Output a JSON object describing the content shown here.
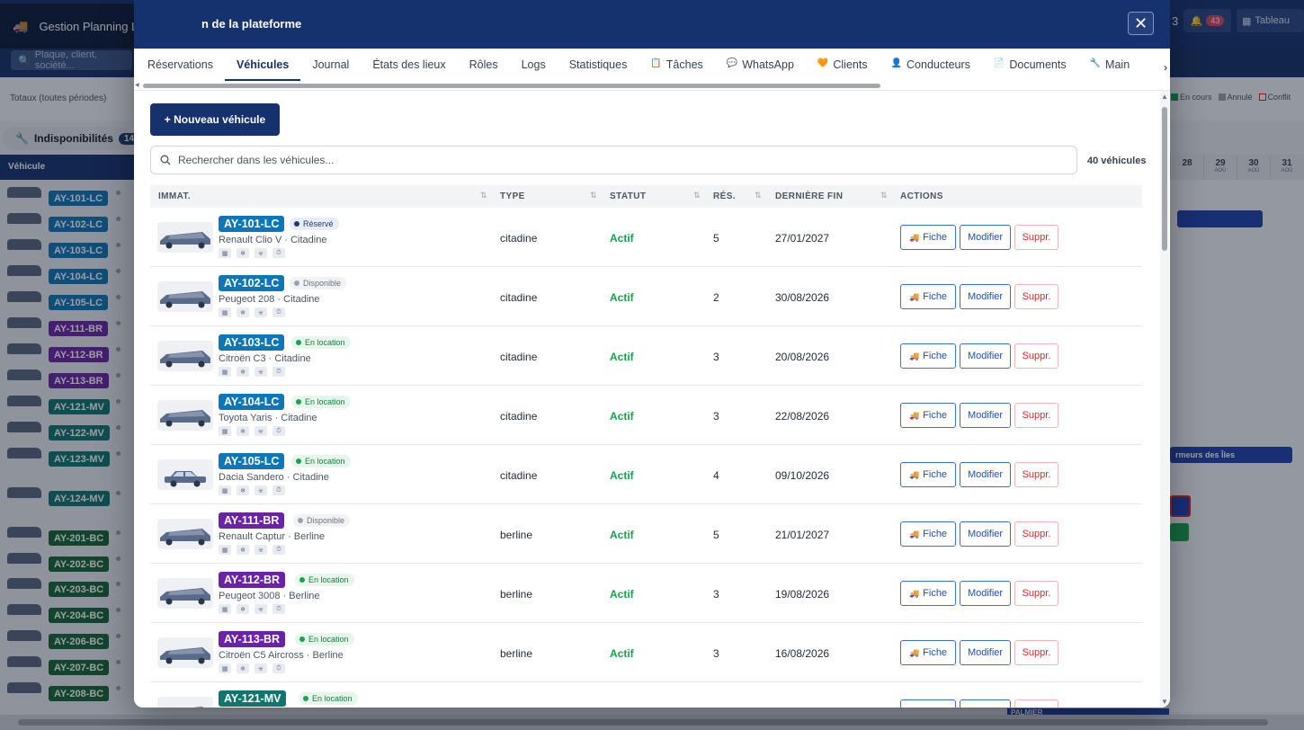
{
  "background": {
    "app_title": "Gestion Planning Lite",
    "search_placeholder": "Plaque, client, société...",
    "notif_count": "3",
    "bell_count": "43",
    "board_label": "Tableau",
    "totals_label": "Totaux (toutes périodes)",
    "legend": [
      {
        "label": "En cours",
        "color": "#16a34a"
      },
      {
        "label": "Annulé",
        "color": "#9ca3af"
      },
      {
        "label": "Conflit",
        "color": "#dc2626"
      }
    ],
    "indispo_label": "Indisponibilités",
    "indispo_count": "14",
    "column_header": "Véhicule",
    "rows": [
      {
        "plate": "AY-101-LC",
        "color": "#0b76b8"
      },
      {
        "plate": "AY-102-LC",
        "color": "#0b76b8"
      },
      {
        "plate": "AY-103-LC",
        "color": "#0b76b8"
      },
      {
        "plate": "AY-104-LC",
        "color": "#0b76b8"
      },
      {
        "plate": "AY-105-LC",
        "color": "#0b76b8"
      },
      {
        "plate": "AY-111-BR",
        "color": "#6b21a8"
      },
      {
        "plate": "AY-112-BR",
        "color": "#6b21a8"
      },
      {
        "plate": "AY-113-BR",
        "color": "#6b21a8"
      },
      {
        "plate": "AY-121-MV",
        "color": "#0f766e"
      },
      {
        "plate": "AY-122-MV",
        "color": "#0f766e"
      },
      {
        "plate": "AY-123-MV",
        "color": "#0f766e"
      },
      {
        "plate": "AY-124-MV",
        "color": "#0f766e"
      },
      {
        "plate": "AY-201-BC",
        "color": "#166534"
      },
      {
        "plate": "AY-202-BC",
        "color": "#166534"
      },
      {
        "plate": "AY-203-BC",
        "color": "#166534"
      },
      {
        "plate": "AY-204-BC",
        "color": "#166534"
      },
      {
        "plate": "AY-206-BC",
        "color": "#166534"
      },
      {
        "plate": "AY-207-BC",
        "color": "#166534"
      },
      {
        "plate": "AY-208-BC",
        "color": "#166534"
      }
    ],
    "days": [
      {
        "num": "28",
        "month": ""
      },
      {
        "num": "29",
        "month": "AOÛ"
      },
      {
        "num": "30",
        "month": "AOÛ"
      },
      {
        "num": "31",
        "month": "AOÛ"
      }
    ],
    "booking_label": "rmeurs des Îles",
    "palmier_label": "PALMIER"
  },
  "modal": {
    "title": "n de la plateforme",
    "close_label": "✕",
    "tabs": [
      {
        "label": "Réservations",
        "icon": "",
        "active": false
      },
      {
        "label": "Véhicules",
        "icon": "",
        "active": true
      },
      {
        "label": "Journal",
        "icon": "",
        "active": false
      },
      {
        "label": "États des lieux",
        "icon": "",
        "active": false
      },
      {
        "label": "Rôles",
        "icon": "",
        "active": false
      },
      {
        "label": "Logs",
        "icon": "",
        "active": false
      },
      {
        "label": "Statistiques",
        "icon": "",
        "active": false
      },
      {
        "label": "Tâches",
        "icon": "clipboard-icon",
        "active": false
      },
      {
        "label": "WhatsApp",
        "icon": "chat-icon",
        "active": false
      },
      {
        "label": "Clients",
        "icon": "heart-icon",
        "active": false
      },
      {
        "label": "Conducteurs",
        "icon": "user-icon",
        "active": false
      },
      {
        "label": "Documents",
        "icon": "document-icon",
        "active": false
      },
      {
        "label": "Main",
        "icon": "wrench-icon",
        "active": false
      }
    ],
    "new_button": "+ Nouveau véhicule",
    "search_placeholder": "Rechercher dans les véhicules...",
    "vehicle_count": "40 véhicules",
    "columns": [
      "IMMAT.",
      "TYPE",
      "STATUT",
      "RÉS.",
      "DERNIÈRE FIN",
      "ACTIONS"
    ],
    "actions": {
      "fiche": "Fiche",
      "modifier": "Modifier",
      "suppr": "Suppr."
    },
    "vehicles": [
      {
        "plate": "AY-101-LC",
        "plate_color": "#0b76b8",
        "state": "Réservé",
        "state_style": "reserve",
        "model": "Renault Clio V · Citadine",
        "type": "citadine",
        "status": "Actif",
        "res": "5",
        "last_end": "27/01/2027"
      },
      {
        "plate": "AY-102-LC",
        "plate_color": "#0b76b8",
        "state": "Disponible",
        "state_style": "dispo",
        "model": "Peugeot 208 · Citadine",
        "type": "citadine",
        "status": "Actif",
        "res": "2",
        "last_end": "30/08/2026"
      },
      {
        "plate": "AY-103-LC",
        "plate_color": "#0b76b8",
        "state": "En location",
        "state_style": "loc",
        "model": "Citroën C3 · Citadine",
        "type": "citadine",
        "status": "Actif",
        "res": "3",
        "last_end": "20/08/2026"
      },
      {
        "plate": "AY-104-LC",
        "plate_color": "#0b76b8",
        "state": "En location",
        "state_style": "loc",
        "model": "Toyota Yaris · Citadine",
        "type": "citadine",
        "status": "Actif",
        "res": "3",
        "last_end": "22/08/2026"
      },
      {
        "plate": "AY-105-LC",
        "plate_color": "#0b76b8",
        "state": "En location",
        "state_style": "loc",
        "model": "Dacia Sandero · Citadine",
        "type": "citadine",
        "status": "Actif",
        "res": "4",
        "last_end": "09/10/2026"
      },
      {
        "plate": "AY-111-BR",
        "plate_color": "#6b21a8",
        "state": "Disponible",
        "state_style": "dispo",
        "model": "Renault Captur · Berline",
        "type": "berline",
        "status": "Actif",
        "res": "5",
        "last_end": "21/01/2027"
      },
      {
        "plate": "AY-112-BR",
        "plate_color": "#6b21a8",
        "state": "En location",
        "state_style": "loc",
        "model": "Peugeot 3008 · Berline",
        "type": "berline",
        "status": "Actif",
        "res": "3",
        "last_end": "19/08/2026"
      },
      {
        "plate": "AY-113-BR",
        "plate_color": "#6b21a8",
        "state": "En location",
        "state_style": "loc",
        "model": "Citroën C5 Aircross · Berline",
        "type": "berline",
        "status": "Actif",
        "res": "3",
        "last_end": "16/08/2026"
      },
      {
        "plate": "AY-121-MV",
        "plate_color": "#0f766e",
        "state": "En location",
        "state_style": "loc",
        "model": "",
        "type": "",
        "status": "",
        "res": "",
        "last_end": ""
      }
    ],
    "state_styles": {
      "reserve": {
        "bg": "#e8edf7",
        "fg": "#1e3a70",
        "dot": "#1e3a70"
      },
      "dispo": {
        "bg": "#f1f2f4",
        "fg": "#6b7280",
        "dot": "#9ca3af"
      },
      "loc": {
        "bg": "#e7f6ec",
        "fg": "#15803d",
        "dot": "#16a34a"
      }
    }
  }
}
